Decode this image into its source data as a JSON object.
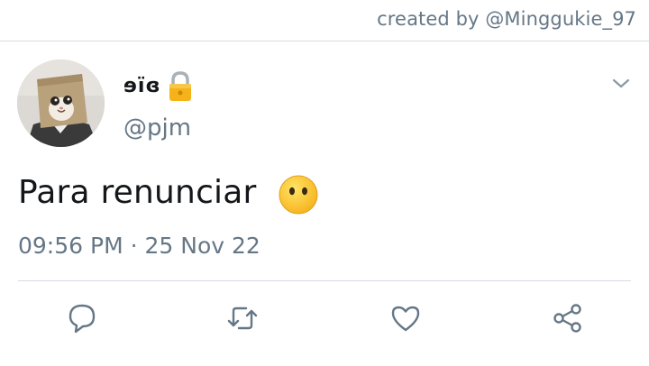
{
  "header": {
    "credit": "created by @Minggukie_97"
  },
  "tweet": {
    "display_name": "ɘïɞ",
    "handle": "@pjm",
    "text": "Para renunciar",
    "timestamp": "09:56 PM · 25 Nov 22",
    "lock_icon": "lock-icon",
    "emoji": "face-without-mouth"
  },
  "actions": [
    {
      "icon": "reply-icon"
    },
    {
      "icon": "retweet-icon"
    },
    {
      "icon": "like-icon"
    },
    {
      "icon": "share-icon"
    }
  ],
  "colors": {
    "secondary_text": "#657786",
    "primary_text": "#14171a",
    "divider": "#d6dbe0",
    "icon": "#657786"
  }
}
